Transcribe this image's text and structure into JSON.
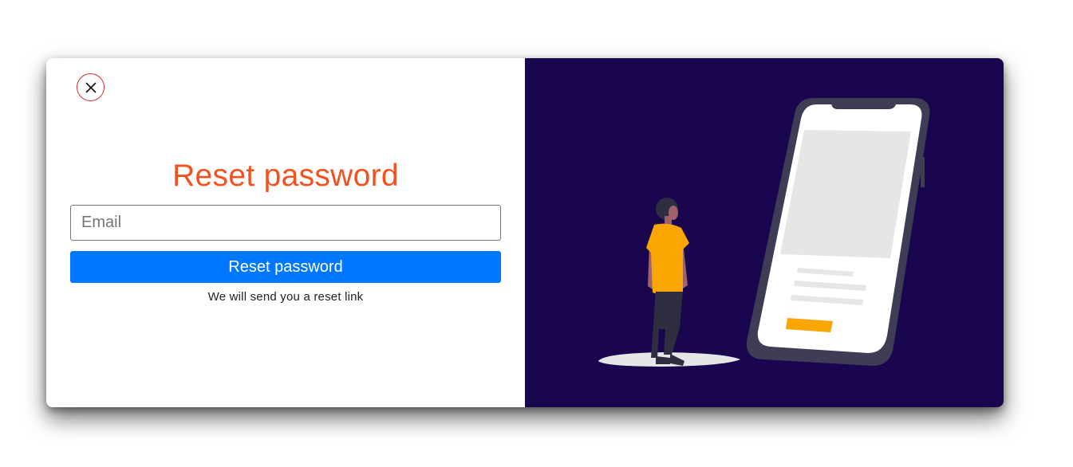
{
  "modal": {
    "close_icon": "close-icon",
    "title": "Reset password",
    "email": {
      "placeholder": "Email",
      "value": ""
    },
    "submit_label": "Reset password",
    "hint": "We will send you a reset link"
  },
  "illustration": {
    "subject": "person-looking-at-phone",
    "icon": "phone-illustration"
  },
  "colors": {
    "title": "#f4511e",
    "button": "#0077ff",
    "close_border": "#e0292b",
    "illustration_bg": "#1a064f",
    "accent": "#f9a602"
  }
}
